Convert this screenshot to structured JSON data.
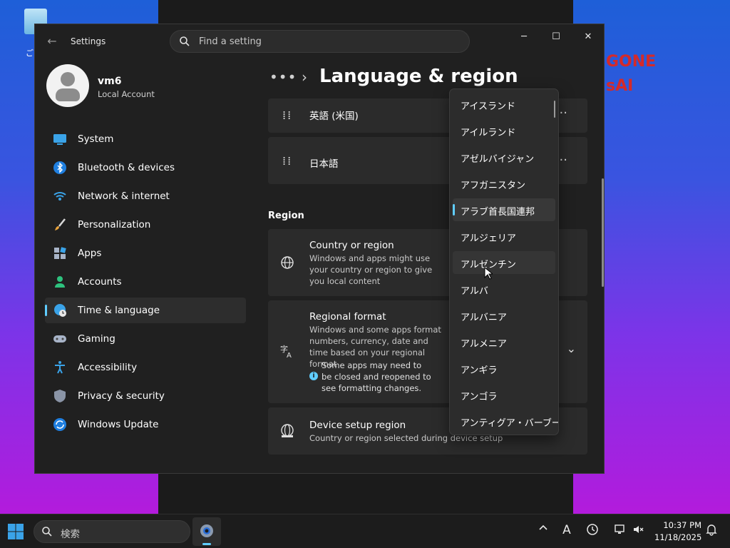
{
  "desktop": {
    "recycle_label": "ご",
    "overlay_line1": "GONE",
    "overlay_line2": "sAI"
  },
  "window": {
    "app_title": "Settings",
    "search_placeholder": "Find a setting",
    "controls": {
      "minimize": "─",
      "maximize": "☐",
      "close": "✕"
    }
  },
  "profile": {
    "name": "vm6",
    "account_type": "Local Account"
  },
  "sidebar": {
    "items": [
      {
        "label": "System",
        "icon": "monitor-icon"
      },
      {
        "label": "Bluetooth & devices",
        "icon": "bluetooth-icon"
      },
      {
        "label": "Network & internet",
        "icon": "wifi-icon"
      },
      {
        "label": "Personalization",
        "icon": "brush-icon"
      },
      {
        "label": "Apps",
        "icon": "apps-icon"
      },
      {
        "label": "Accounts",
        "icon": "person-icon"
      },
      {
        "label": "Time & language",
        "icon": "globe-clock-icon",
        "active": true
      },
      {
        "label": "Gaming",
        "icon": "gamepad-icon"
      },
      {
        "label": "Accessibility",
        "icon": "accessibility-icon"
      },
      {
        "label": "Privacy & security",
        "icon": "shield-icon"
      },
      {
        "label": "Windows Update",
        "icon": "update-icon"
      }
    ]
  },
  "header": {
    "breadcrumb_more": "•••",
    "breadcrumb_sep": "›",
    "title": "Language & region"
  },
  "languages": [
    {
      "name": "英語 (米国)",
      "more": "···"
    },
    {
      "name": "日本語",
      "more": "···"
    }
  ],
  "region": {
    "section_title": "Region",
    "country": {
      "title": "Country or region",
      "desc": "Windows and apps might use your country or region to give you local content"
    },
    "format": {
      "title": "Regional format",
      "desc": "Windows and some apps format numbers, currency, date and time based on your regional format",
      "info": "Some apps may need to be closed and reopened to see formatting changes.",
      "info_icon": "i",
      "chevron": "⌄"
    },
    "device_setup": {
      "title": "Device setup region",
      "desc": "Country or region selected during device setup"
    }
  },
  "dropdown": {
    "options": [
      "アイスランド",
      "アイルランド",
      "アゼルバイジャン",
      "アフガニスタン",
      "アラブ首長国連邦",
      "アルジェリア",
      "アルゼンチン",
      "アルバ",
      "アルバニア",
      "アルメニア",
      "アンギラ",
      "アンゴラ",
      "アンティグア・バーブーダ"
    ],
    "selected": "アラブ首長国連邦",
    "hovered": "アルゼンチン"
  },
  "taskbar": {
    "search_placeholder": "検索",
    "time": "10:37 PM",
    "date": "11/18/2025",
    "tray_ime": "A",
    "colors": {
      "accent": "#60cdff"
    }
  }
}
